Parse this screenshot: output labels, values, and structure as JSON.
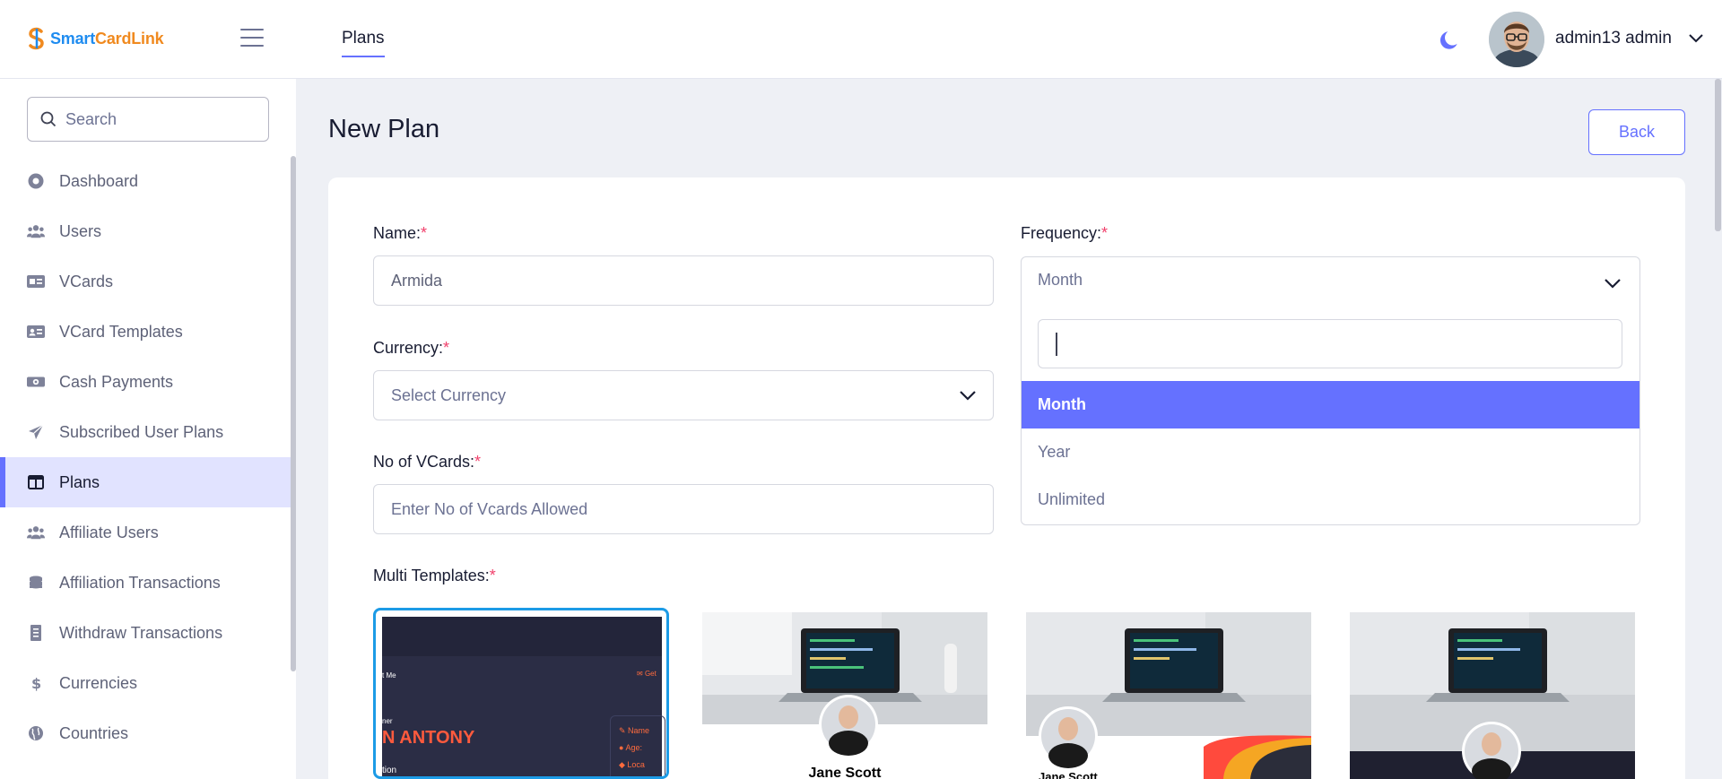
{
  "header": {
    "logo_part1": "Smart",
    "logo_part2": "CardLink",
    "active_tab": "Plans",
    "user_name": "admin13 admin"
  },
  "sidebar": {
    "search_placeholder": "Search",
    "items": [
      {
        "label": "Dashboard",
        "icon": "dashboard-icon"
      },
      {
        "label": "Users",
        "icon": "users-icon"
      },
      {
        "label": "VCards",
        "icon": "vcard-icon"
      },
      {
        "label": "VCard Templates",
        "icon": "vcard-templates-icon"
      },
      {
        "label": "Cash Payments",
        "icon": "cash-icon"
      },
      {
        "label": "Subscribed User Plans",
        "icon": "paper-plane-icon"
      },
      {
        "label": "Plans",
        "icon": "table-icon"
      },
      {
        "label": "Affiliate Users",
        "icon": "users-icon"
      },
      {
        "label": "Affiliation Transactions",
        "icon": "coins-icon"
      },
      {
        "label": "Withdraw Transactions",
        "icon": "receipt-icon"
      },
      {
        "label": "Currencies",
        "icon": "dollar-icon"
      },
      {
        "label": "Countries",
        "icon": "globe-icon"
      }
    ],
    "active_index": 6
  },
  "main": {
    "title": "New Plan",
    "back_label": "Back",
    "form": {
      "name_label": "Name:",
      "name_value": "Armida",
      "currency_label": "Currency:",
      "currency_placeholder": "Select Currency",
      "vcards_label": "No of VCards:",
      "vcards_placeholder": "Enter No of Vcards Allowed",
      "frequency_label": "Frequency:",
      "frequency_value": "Month",
      "frequency_options": [
        "Month",
        "Year",
        "Unlimited"
      ],
      "multi_templates_label": "Multi Templates:",
      "required_mark": "*"
    },
    "templates": {
      "t1_text_contact": "t Me",
      "t1_text_get": "Get",
      "t1_text_role": "ner",
      "t1_text_name": "N ANTONY",
      "t1_text_tion": "tion",
      "t1_fields": [
        "Name",
        "Age:",
        "Loca"
      ],
      "t2_name": "Jane Scott",
      "t3_name": "Jane Scott"
    }
  },
  "colors": {
    "accent": "#6571ff",
    "required": "#f1416c",
    "selected_template_border": "#1c9be6"
  }
}
